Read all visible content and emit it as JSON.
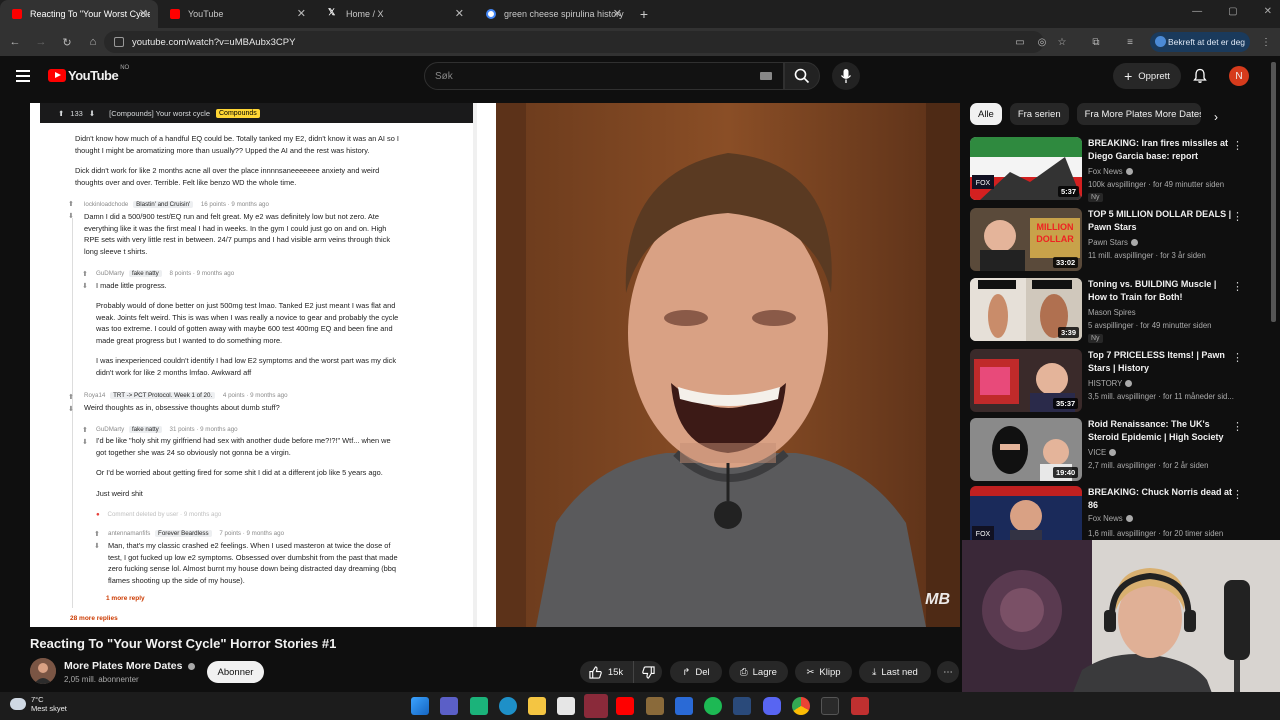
{
  "browser": {
    "tabs": [
      {
        "title": "Reacting To \"Your Worst Cycle\"",
        "color": "#ff0000",
        "active": true
      },
      {
        "title": "YouTube",
        "color": "#ff0000",
        "active": false
      },
      {
        "title": "Home / X",
        "color": "#ffffff",
        "active": false
      },
      {
        "title": "green cheese spirulina history",
        "color": "#4285f4",
        "active": false
      }
    ],
    "url": "youtube.com/watch?v=uMBAubx3CPY",
    "profile_label": "Bekreft at det er deg"
  },
  "header": {
    "logo_text": "YouTube",
    "logo_country": "NO",
    "search_placeholder": "Søk",
    "create_label": "Opprett",
    "avatar_letter": "N"
  },
  "reddit": {
    "header_votes": "133",
    "header_title": "[Compounds] Your worst cycle",
    "header_flair": "Compounds",
    "lines": [
      "Didn't know how much of a handful EQ could be. Totally tanked my E2, didn't know it was an AI so I",
      "thought I might be aromatizing more than usually?? Upped the AI and the rest was history.",
      "Dick didn't work for like 2 months acne all over the place innnnsaneeeeeee anxiety and weird",
      "thoughts over and over. Terrible. Felt like benzo WD the whole time."
    ],
    "c1_meta": {
      "user": "lockinloadchode",
      "tag": "Blastin' and Cruisin'",
      "info": "16 points · 9 months ago"
    },
    "c1_lines": [
      "Damn I did a 500/900 test/EQ run and felt great. My e2 was definitely low but not zero. Ate",
      "everything like it was the first meal I had in weeks. In the gym I could just go on and on. High",
      "RPE sets with very little rest in between. 24/7 pumps and I had visible arm veins through thick",
      "long sleeve t shirts."
    ],
    "c2_meta": {
      "user": "GuDMarty",
      "tag": "fake natty",
      "info": "8 points · 9 months ago"
    },
    "c2_line": "I made little progress.",
    "c2b_lines": [
      "Probably would of done better on just 500mg test lmao. Tanked E2 just meant I was flat and",
      "weak. Joints felt weird. This is was when I was really a novice to gear and probably the cycle",
      "was too extreme. I could of gotten away with maybe 600 test 400mg EQ and been fine and",
      "made great progress but I wanted to do something more.",
      "I was inexperienced couldn't identify I had low E2 symptoms and the worst part was my dick",
      "didn't work for like 2 months lmfao. Awkward aff"
    ],
    "c3_meta": {
      "user": "Roya14",
      "tag": "TRT -> PCT Protocol. Week 1 of 20.",
      "info": "4 points · 9 months ago"
    },
    "c3_line": "Weird thoughts as in, obsessive thoughts about dumb stuff?",
    "c4_meta": {
      "user": "GuDMarty",
      "tag": "fake natty",
      "info": "31 points · 9 months ago"
    },
    "c4_lines": [
      "I'd be like \"holy shit my girlfriend had sex with another dude before me?!?!\" Wtf... when we",
      "got together she was 24 so obviously not gonna be a virgin.",
      "Or I'd be worried about getting fired for some shit I did at a different job like 5 years ago.",
      "Just weird shit"
    ],
    "deleted": "Comment deleted by user · 9 months ago",
    "c5_meta": {
      "user": "antennamanfifs",
      "tag": "Forever Beardless",
      "info": "7 points · 9 months ago"
    },
    "c5_lines": [
      "Man, that's my classic crashed e2 feelings. When I used masteron at twice the dose of",
      "test, I got fucked up low e2 symptoms. Obsessed over dumbshit from the past that made",
      "zero fucking sense lol. Almost burnt my house down being distracted day dreaming (bbq",
      "flames shooting up the side of my house)."
    ],
    "more_reply": "1 more reply",
    "more_replies": "28 more replies"
  },
  "video": {
    "title": "Reacting To \"Your Worst Cycle\" Horror Stories #1",
    "watermark": "MB",
    "channel": "More Plates More Dates",
    "subs": "2,05 mill. abonnenter",
    "subscribe": "Abonner",
    "likes": "15k",
    "share": "Del",
    "save": "Lagre",
    "clip": "Klipp",
    "download": "Last ned"
  },
  "chips": [
    "Alle",
    "Fra serien",
    "Fra More Plates More Dates"
  ],
  "recommendations": [
    {
      "title": "BREAKING: Iran fires missiles at Diego Garcia base: report",
      "channel": "Fox News",
      "stats": "100k avspillinger · for 49 minutter siden",
      "badge": "Ny",
      "duration": "5:37"
    },
    {
      "title": "TOP 5 MILLION DOLLAR DEALS | Pawn Stars",
      "channel": "Pawn Stars",
      "stats": "11 mill. avspillinger · for 3 år siden",
      "badge": "",
      "duration": "33:02"
    },
    {
      "title": "Toning vs. BUILDING Muscle | How to Train for Both!",
      "channel": "Mason Spires",
      "stats": "5 avspillinger · for 49 minutter siden",
      "badge": "Ny",
      "duration": "3:39"
    },
    {
      "title": "Top 7 PRICELESS Items! | Pawn Stars | History",
      "channel": "HISTORY",
      "stats": "3,5 mill. avspillinger · for 11 måneder sid...",
      "badge": "",
      "duration": "35:37"
    },
    {
      "title": "Roid Renaissance: The UK's Steroid Epidemic | High Society",
      "channel": "VICE",
      "stats": "2,7 mill. avspillinger · for 2 år siden",
      "badge": "",
      "duration": "19:40"
    },
    {
      "title": "BREAKING: Chuck Norris dead at 86",
      "channel": "Fox News",
      "stats": "1,6 mill. avspillinger · for 20 timer siden",
      "badge": "",
      "duration": ""
    }
  ],
  "taskbar": {
    "temp": "7°C",
    "weather": "Mest skyet"
  }
}
